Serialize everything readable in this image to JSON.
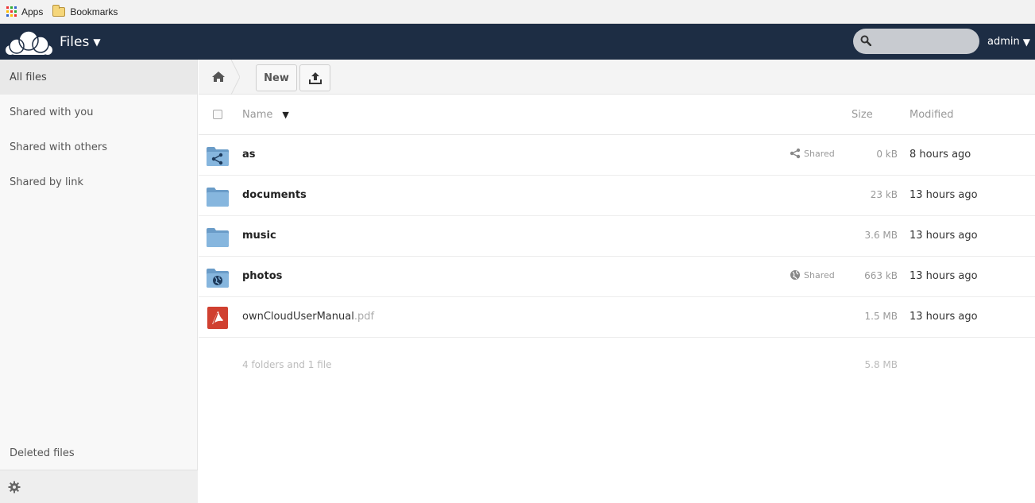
{
  "bookmarks_bar": {
    "apps_label": "Apps",
    "bookmarks_label": "Bookmarks"
  },
  "header": {
    "app_title": "Files",
    "search_placeholder": "",
    "user": "admin"
  },
  "sidebar": {
    "items": [
      {
        "label": "All files",
        "active": true
      },
      {
        "label": "Shared with you",
        "active": false
      },
      {
        "label": "Shared with others",
        "active": false
      },
      {
        "label": "Shared by link",
        "active": false
      }
    ],
    "deleted_label": "Deleted files"
  },
  "controls": {
    "new_label": "New"
  },
  "table": {
    "headers": {
      "name": "Name",
      "size": "Size",
      "modified": "Modified"
    },
    "rows": [
      {
        "name": "as",
        "ext": "",
        "type": "folder-shared",
        "shared_label": "Shared",
        "share_icon": "share-icon",
        "size": "0 kB",
        "modified": "8 hours ago"
      },
      {
        "name": "documents",
        "ext": "",
        "type": "folder",
        "shared_label": "",
        "size": "23 kB",
        "modified": "13 hours ago"
      },
      {
        "name": "music",
        "ext": "",
        "type": "folder",
        "shared_label": "",
        "size": "3.6 MB",
        "modified": "13 hours ago"
      },
      {
        "name": "photos",
        "ext": "",
        "type": "folder-public",
        "shared_label": "Shared",
        "share_icon": "globe-icon",
        "size": "663 kB",
        "modified": "13 hours ago"
      },
      {
        "name": "ownCloudUserManual",
        "ext": ".pdf",
        "type": "pdf",
        "shared_label": "",
        "size": "1.5 MB",
        "modified": "13 hours ago"
      }
    ],
    "summary": {
      "label": "4 folders and 1 file",
      "size": "5.8 MB"
    }
  },
  "colors": {
    "header_bg": "#1d2d44",
    "folder_blue": "#7fb0d8"
  }
}
